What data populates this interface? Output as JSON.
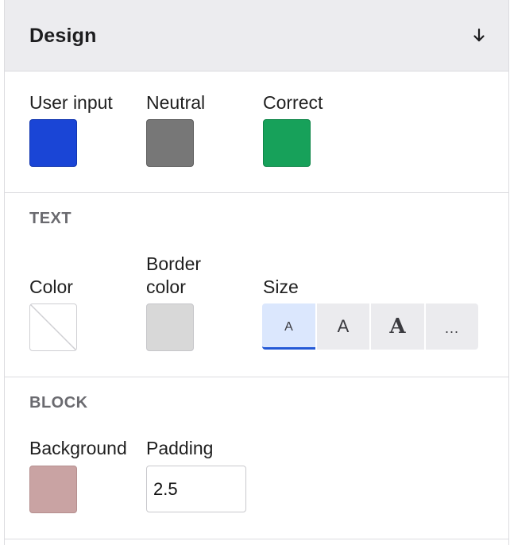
{
  "header": {
    "title": "Design",
    "collapse_icon": "arrow-down-icon"
  },
  "colors_section": {
    "items": [
      {
        "label": "User input",
        "color": "#1a45d6"
      },
      {
        "label": "Neutral",
        "color": "#777777"
      },
      {
        "label": "Correct",
        "color": "#17a15a"
      }
    ]
  },
  "text_section": {
    "title": "TEXT",
    "color_label": "Color",
    "color_value": "none",
    "border_color_label_line1": "Border",
    "border_color_label_line2": "color",
    "border_color_value": "#d8d8d8",
    "size_label": "Size",
    "size_options": [
      {
        "label": "A",
        "selected": true
      },
      {
        "label": "A",
        "selected": false
      },
      {
        "label": "A",
        "selected": false
      },
      {
        "label": "...",
        "selected": false
      }
    ]
  },
  "block_section": {
    "title": "BLOCK",
    "background_label": "Background",
    "background_color": "#c9a3a3",
    "padding_label": "Padding",
    "padding_value": "2.5"
  }
}
